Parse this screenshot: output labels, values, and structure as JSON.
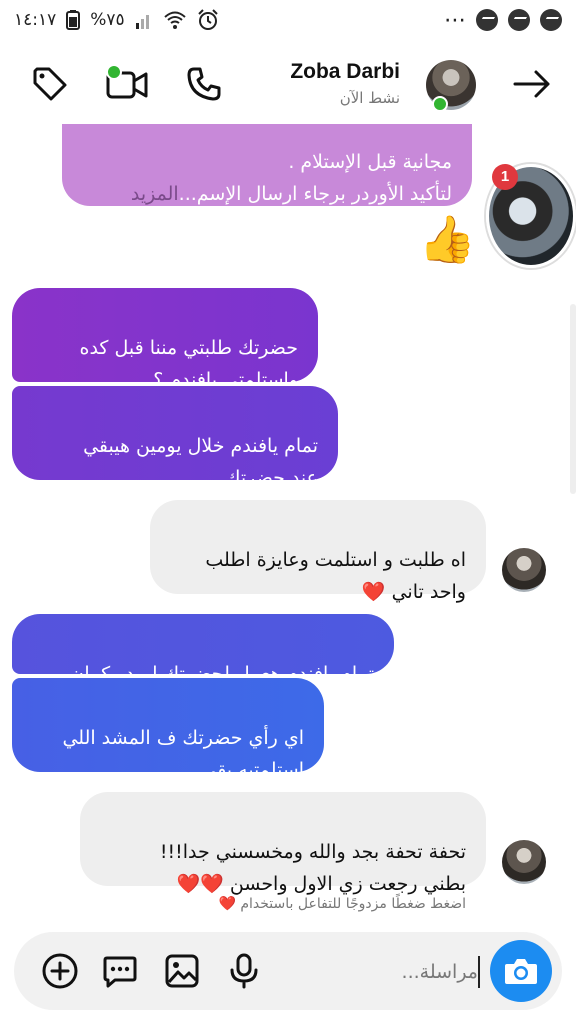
{
  "status_bar": {
    "time": "١٤:١٧",
    "battery": "%٧٥",
    "icons": [
      "battery-icon",
      "signal-icon",
      "wifi-icon",
      "alarm-icon",
      "more-dots-icon",
      "messenger-icon",
      "messenger-icon",
      "messenger-icon"
    ]
  },
  "header": {
    "contact_name": "Zoba Darbi",
    "contact_status": "نشط الآن",
    "icons": [
      "tag-icon",
      "video-call-icon",
      "phone-icon",
      "back-arrow-icon"
    ]
  },
  "messages": [
    {
      "id": "m0",
      "direction": "out",
      "text": "مجانية قبل الإستلام .\nلتأكيد الأوردر برجاء ارسال الإسم...",
      "more": "المزيد",
      "color": "#c889d9"
    },
    {
      "id": "m1",
      "direction": "out",
      "text": "حضرتك طلبتي  مننا قبل كده\nواستلمتي يافندم ؟",
      "color_from": "#8a33c9",
      "color_to": "#7a35cf"
    },
    {
      "id": "m2",
      "direction": "out",
      "text": "تمام يافندم خلال يومين هيبقي\nعند حضرتك",
      "color_from": "#7639cf",
      "color_to": "#6a3fd4"
    },
    {
      "id": "m3",
      "direction": "in",
      "text": "اه طلبت و استلمت وعايزة اطلب\nواحد تاني ❤️"
    },
    {
      "id": "m4",
      "direction": "out",
      "text": "تمام يافندم هعمل لحضرتك اوردر كمان",
      "color_from": "#5653dd",
      "color_to": "#4d5ae0"
    },
    {
      "id": "m5",
      "direction": "out",
      "text": "اي رأي حضرتك ف المشد اللي\nاستلمتيه بقي",
      "color_from": "#4760e5",
      "color_to": "#3d6ae8"
    },
    {
      "id": "m6",
      "direction": "in",
      "text": "تحفة تحفة بجد   والله ومخسسني جدا!!!\nبطني رجعت زي الاول واحسن ❤️❤️"
    }
  ],
  "notification_badge": "1",
  "reaction_hint": "اضغط ضغطًا مزدوجًا للتفاعل باستخدام",
  "reaction_hint_emoji": "❤️",
  "thumbs_up": "👍",
  "composer": {
    "placeholder": "مراسلة...",
    "icons": [
      "add-icon",
      "chat-more-icon",
      "gallery-icon",
      "microphone-icon",
      "camera-icon"
    ]
  },
  "colors": {
    "online": "#31b531",
    "accent": "#1c8cf1",
    "badge": "#e0383e",
    "incoming_bg": "#eeeeee"
  }
}
